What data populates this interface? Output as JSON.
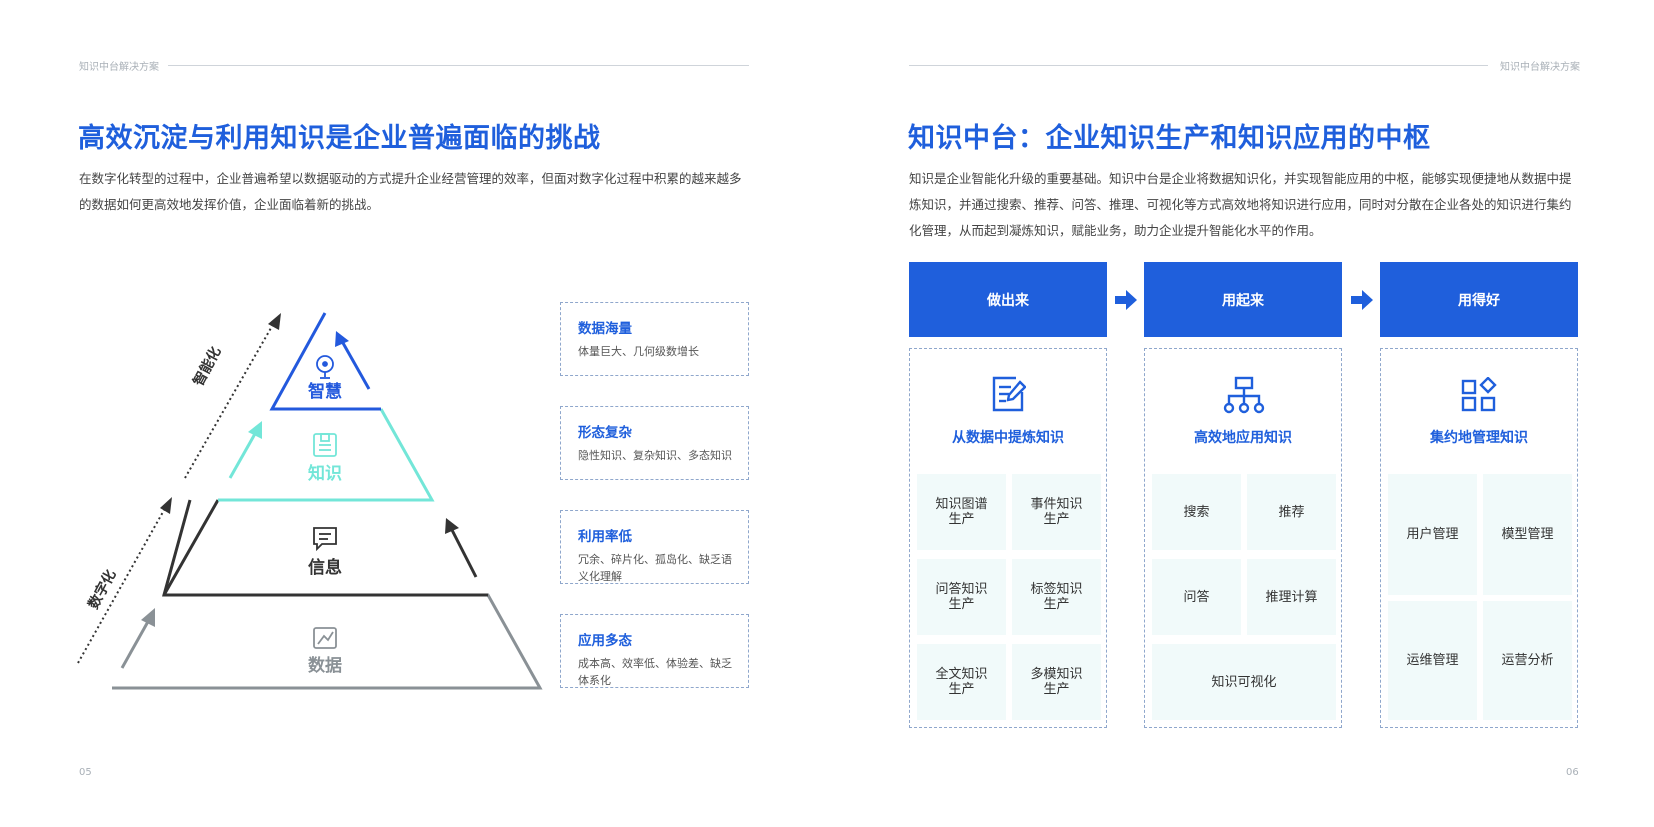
{
  "left": {
    "header": "知识中台解决方案",
    "title": "高效沉淀与利用知识是企业普遍面临的挑战",
    "intro": "在数字化转型的过程中，企业普遍希望以数据驱动的方式提升企业经营管理的效率，但面对数字化过程中积累的越来越多的数据如何更高效地发挥价值，企业面临着新的挑战。",
    "pyramid": {
      "levels": [
        {
          "label": "智慧",
          "color": "#2359dd",
          "icon": "lightbulb-icon"
        },
        {
          "label": "知识",
          "color": "#73e6d8",
          "icon": "document-icon"
        },
        {
          "label": "信息",
          "color": "#333333",
          "icon": "message-icon"
        },
        {
          "label": "数据",
          "color": "#8a9196",
          "icon": "trend-chart-icon"
        }
      ],
      "axis_upper": "智能化",
      "axis_lower": "数字化"
    },
    "callouts": [
      {
        "title": "数据海量",
        "text": "体量巨大、几何级数增长"
      },
      {
        "title": "形态复杂",
        "text": "隐性知识、复杂知识、多态知识"
      },
      {
        "title": "利用率低",
        "text": "冗余、碎片化、孤岛化、缺乏语义化理解"
      },
      {
        "title": "应用多态",
        "text": "成本高、效率低、体验差、缺乏体系化"
      }
    ],
    "page_number": "05"
  },
  "right": {
    "header": "知识中台解决方案",
    "title": "知识中台：企业知识生产和知识应用的中枢",
    "intro": "知识是企业智能化升级的重要基础。知识中台是企业将数据知识化，并实现智能应用的中枢，能够实现便捷地从数据中提炼知识，并通过搜索、推荐、问答、推理、可视化等方式高效地将知识进行应用，同时对分散在企业各处的知识进行集约化管理，从而起到凝炼知识，赋能业务，助力企业提升智能化水平的作用。",
    "columns": [
      {
        "header": "做出来",
        "icon": "edit-document-icon",
        "title": "从数据中提炼知识",
        "cells": [
          "知识图谱\n生产",
          "事件知识\n生产",
          "问答知识\n生产",
          "标签知识\n生产",
          "全文知识\n生产",
          "多模知识\n生产"
        ]
      },
      {
        "header": "用起来",
        "icon": "hierarchy-icon",
        "title": "高效地应用知识",
        "cells": [
          "搜索",
          "推荐",
          "问答",
          "推理计算",
          "知识可视化"
        ]
      },
      {
        "header": "用得好",
        "icon": "grid-apps-icon",
        "title": "集约地管理知识",
        "cells": [
          "用户管理",
          "模型管理",
          "运维管理",
          "运营分析"
        ]
      }
    ],
    "page_number": "06"
  }
}
